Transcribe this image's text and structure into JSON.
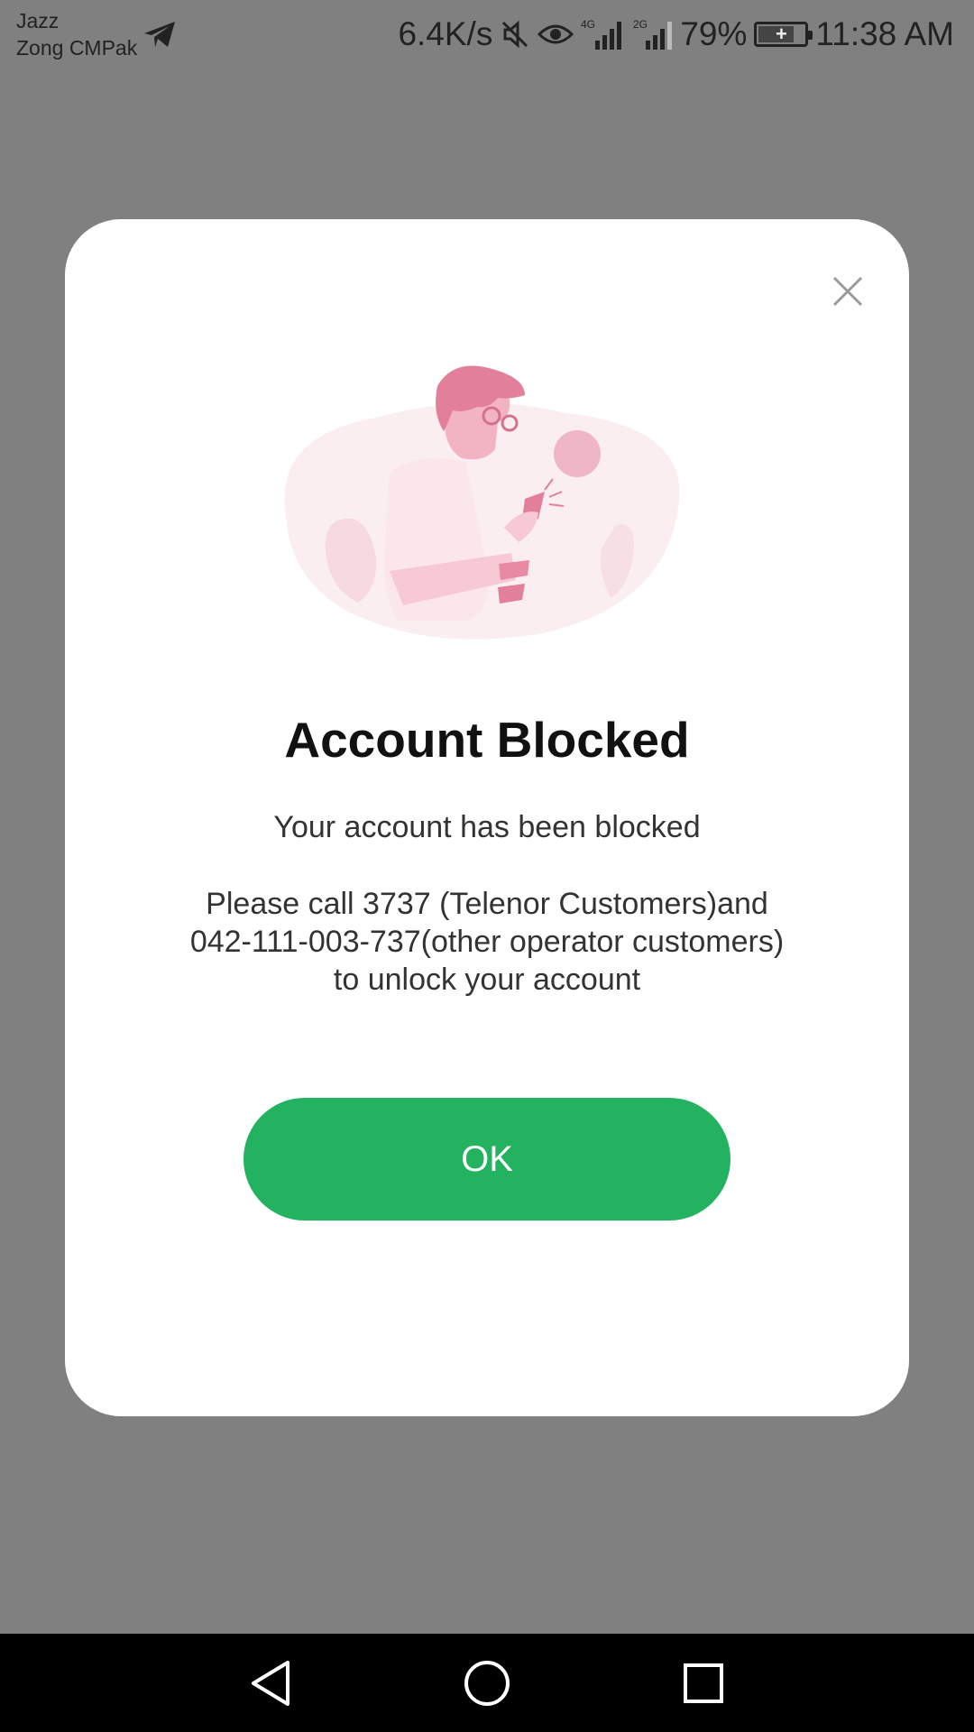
{
  "status_bar": {
    "carrier_1": "Jazz",
    "carrier_2": "Zong CMPak",
    "net_speed": "6.4K/s",
    "net_4g": "4G",
    "net_2g": "2G",
    "battery": "79%",
    "battery_level": 0.79,
    "time": "11:38 AM",
    "icons": [
      "telegram-icon",
      "mute-icon",
      "eye-icon",
      "signal-icon",
      "battery-icon"
    ]
  },
  "dialog": {
    "title": "Account Blocked",
    "message": "Your account has been blocked",
    "instruction_line1": "Please call 3737 (Telenor Customers)and",
    "instruction_line2": "042-111-003-737(other operator customers)",
    "instruction_line3": "to unlock your account",
    "ok_label": "OK",
    "close_icon": "close-icon"
  },
  "nav_bar": {
    "icons": [
      "back-icon",
      "home-icon",
      "recents-icon"
    ]
  },
  "colors": {
    "accent": "#22b260",
    "overlay": "#808080",
    "illustration": "#e8829d"
  }
}
